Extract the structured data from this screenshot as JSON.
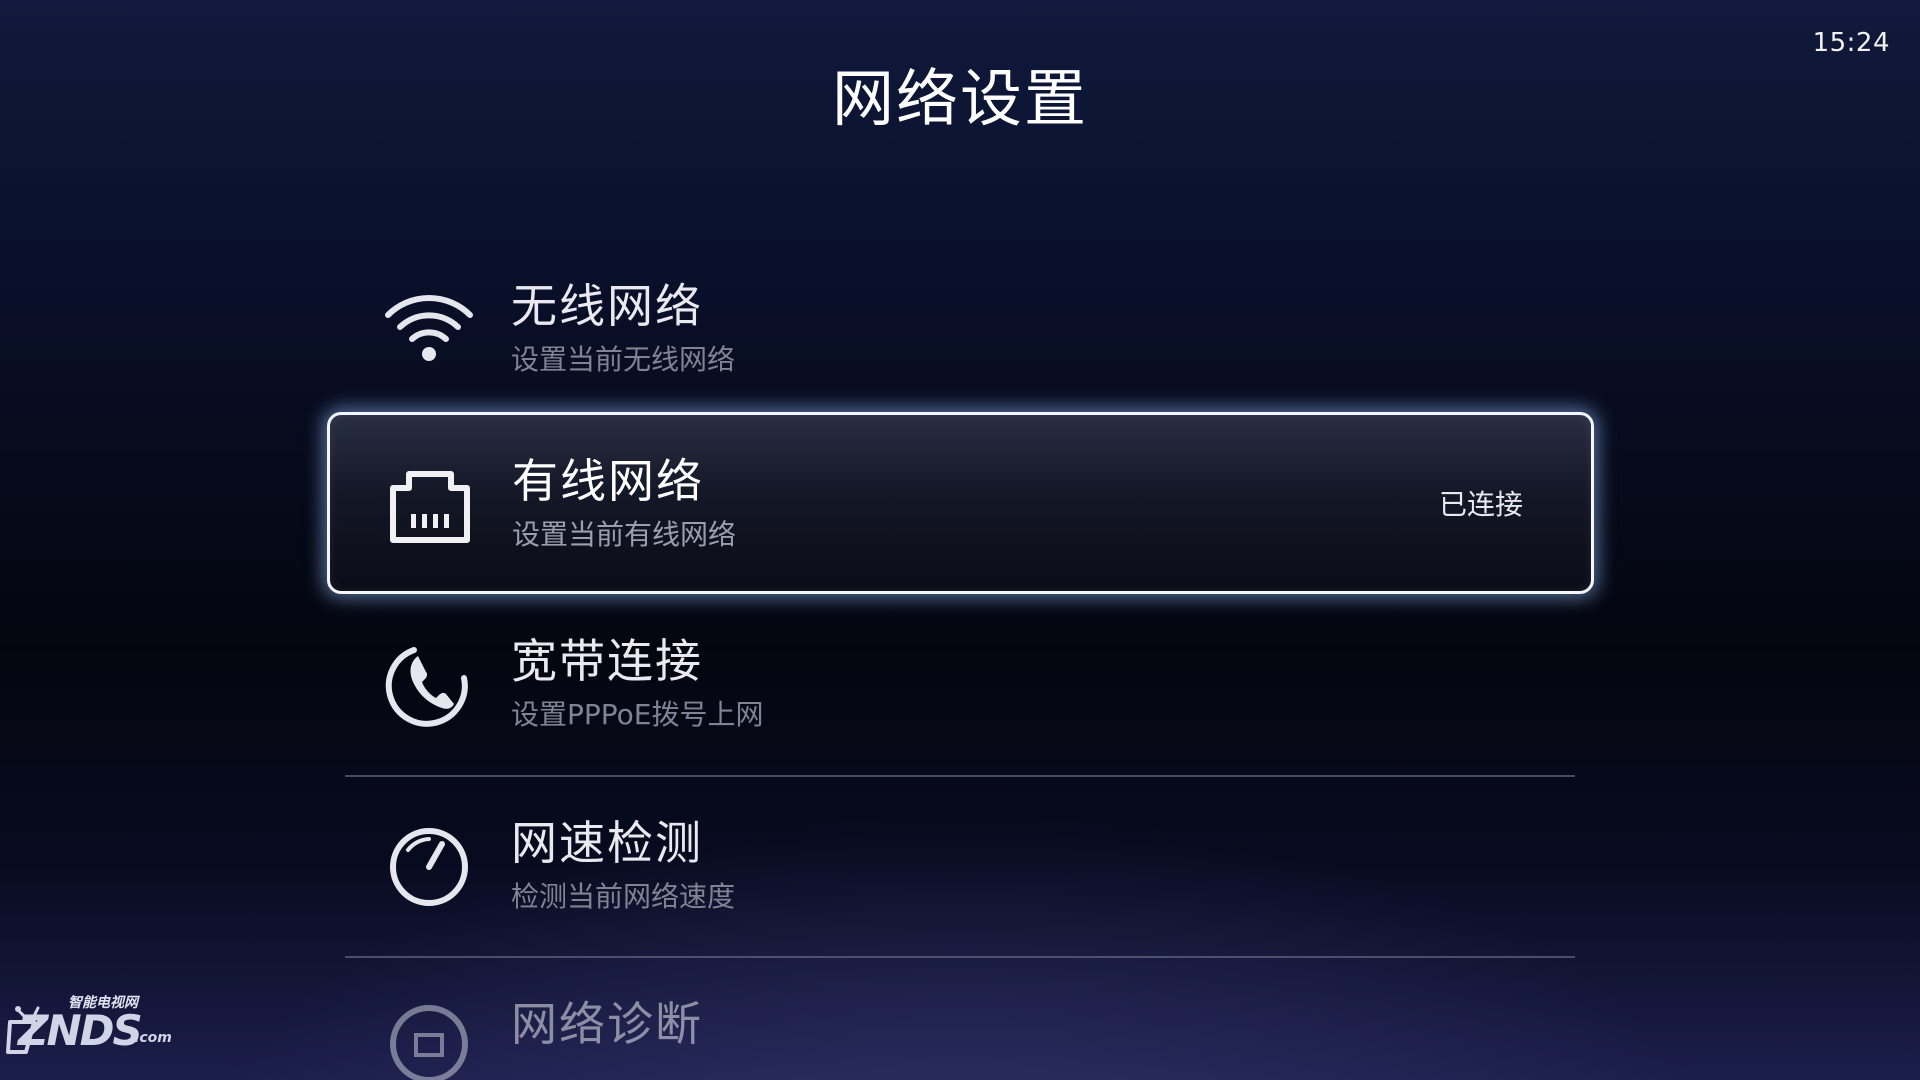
{
  "status_bar": {
    "time": "15:24"
  },
  "page": {
    "title": "网络设置"
  },
  "menu": {
    "items": [
      {
        "label": "无线网络",
        "sub": "设置当前无线网络",
        "icon": "wifi-icon"
      },
      {
        "label": "有线网络",
        "sub": "设置当前有线网络",
        "status": "已连接",
        "icon": "ethernet-port-icon",
        "selected": true
      },
      {
        "label": "宽带连接",
        "sub": "设置PPPoE拨号上网",
        "icon": "phone-dial-icon"
      },
      {
        "label": "网速检测",
        "sub": "检测当前网络速度",
        "icon": "speedometer-icon"
      },
      {
        "label": "网络诊断",
        "icon": "diagnosis-icon"
      }
    ]
  },
  "watermark": {
    "line1": "智能电视网",
    "brand": "ZNDS",
    "suffix": ".com"
  },
  "colors": {
    "accent_border": "#f4f6ff",
    "glow": "#96beff",
    "background": "#04060f"
  }
}
